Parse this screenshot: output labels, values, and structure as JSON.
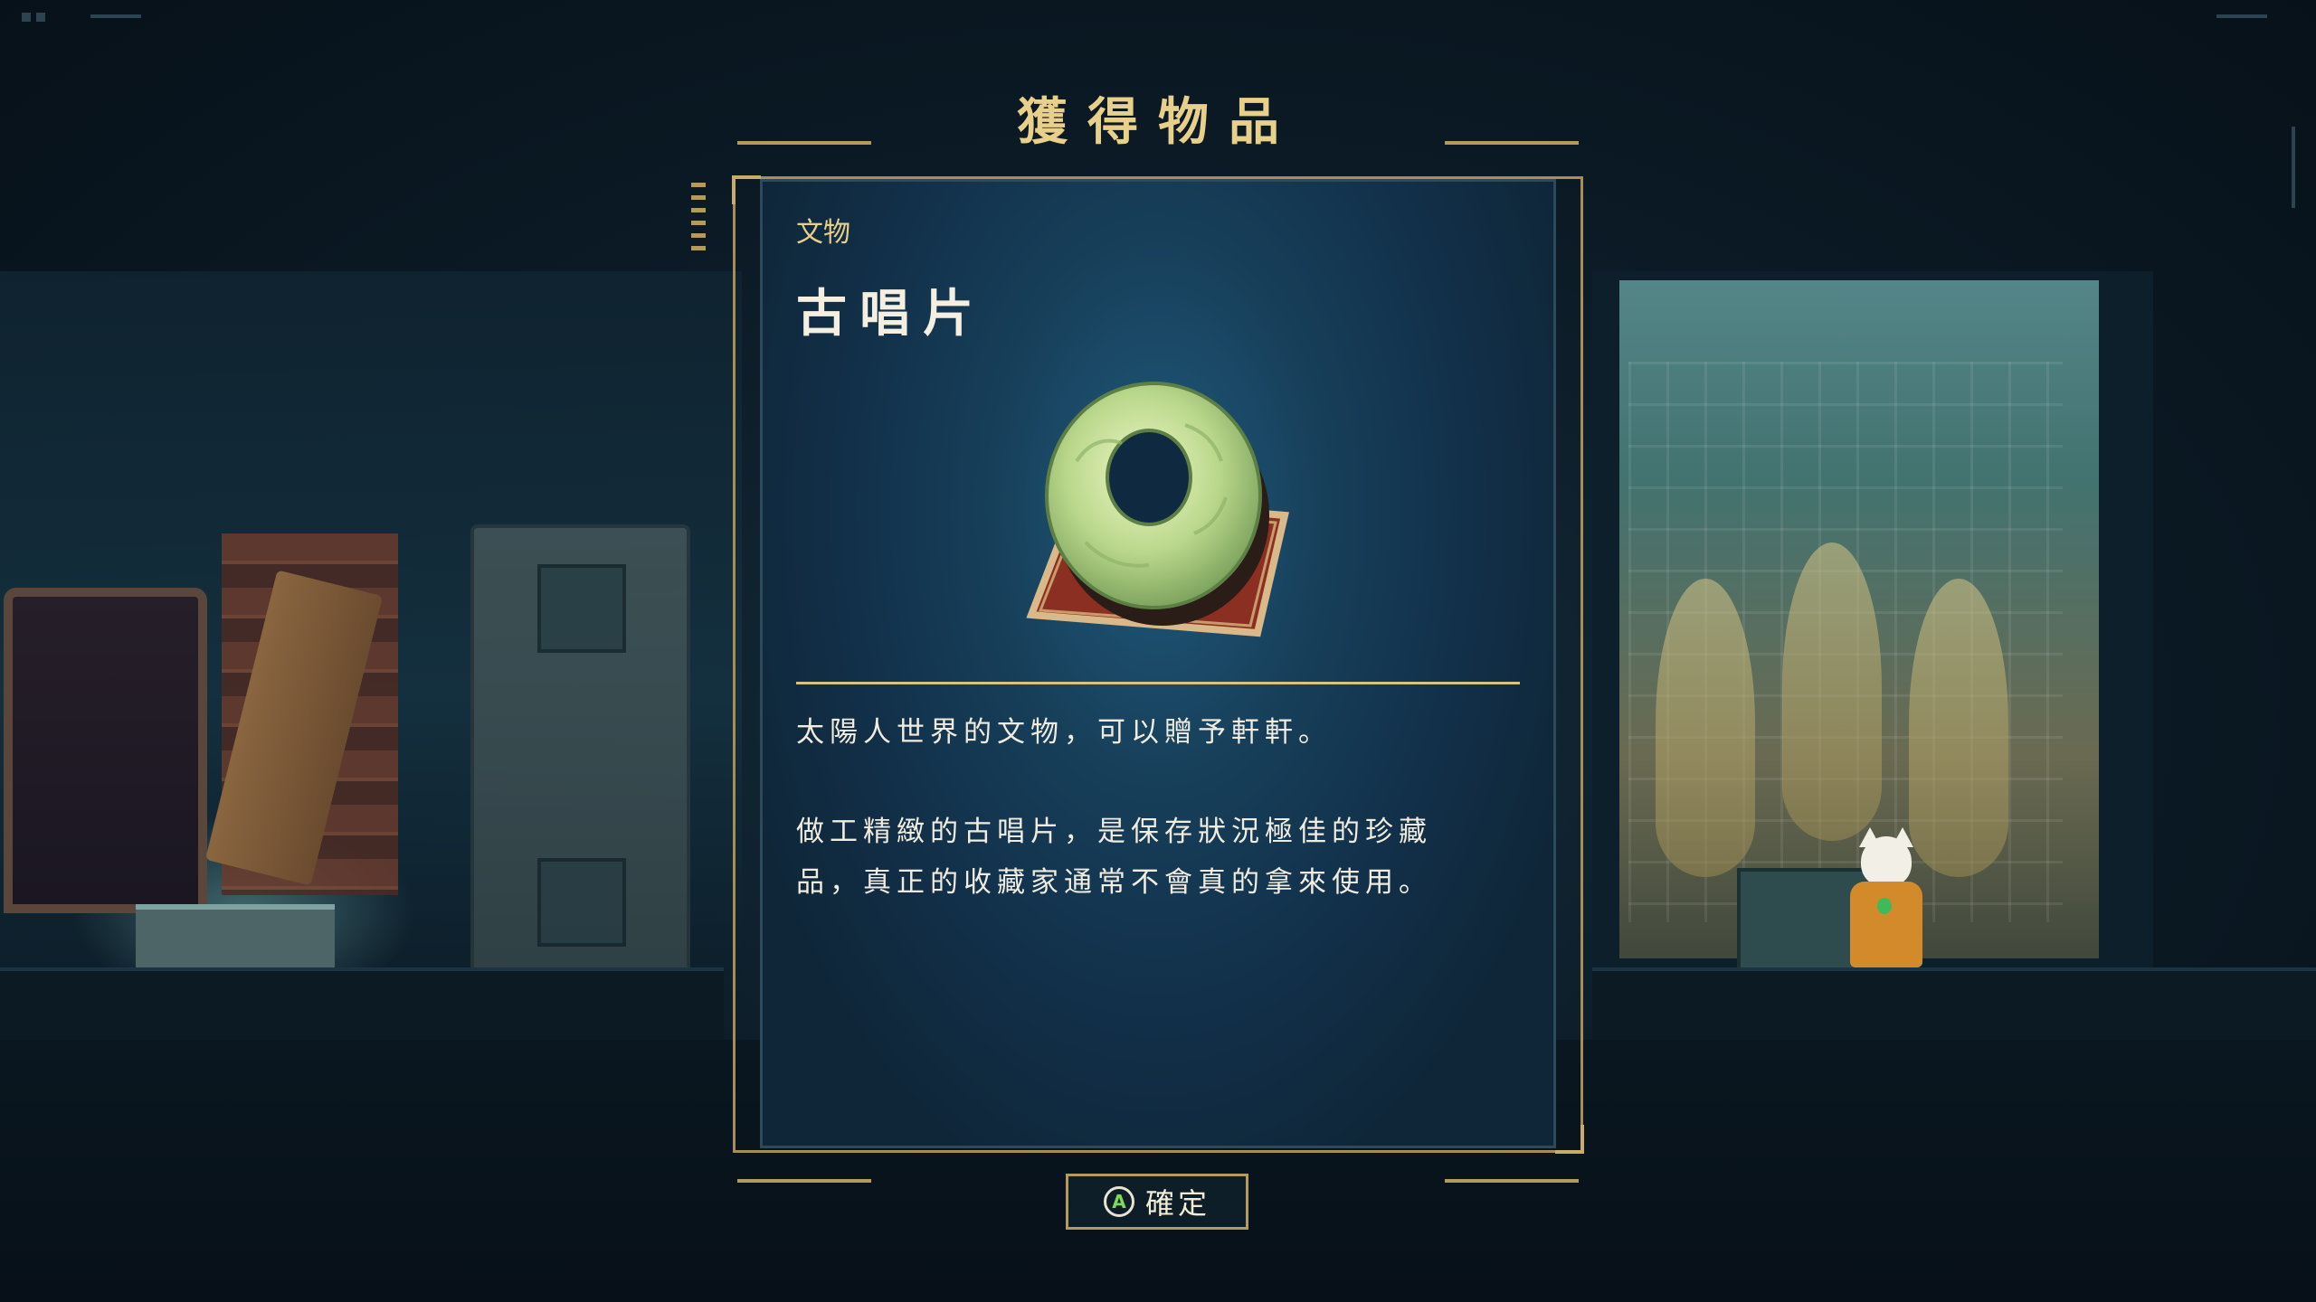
{
  "dialog": {
    "title": "獲得物品",
    "category": "文物",
    "item_name": "古唱片",
    "description_1": "太陽人世界的文物，可以贈予軒軒。",
    "description_2_line1": "做工精緻的古唱片，是保存狀況極佳的珍藏",
    "description_2_line2": "品，真正的收藏家通常不會真的拿來使用。",
    "item_icon": "jade-record-icon"
  },
  "confirm": {
    "button_glyph": "A",
    "label": "確定"
  },
  "colors": {
    "accent_gold": "#e8cf8a",
    "frame_gold": "#b49a5c",
    "card_blue": "#173f5a",
    "button_green": "#7ed957"
  }
}
